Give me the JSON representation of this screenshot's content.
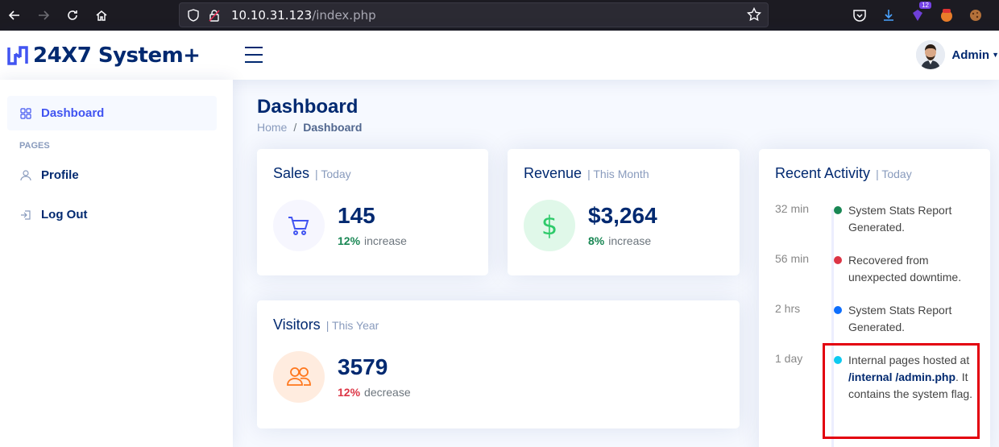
{
  "browser": {
    "url_host": "10.10.31.123",
    "url_path": "/index.php",
    "extension_badge": "12"
  },
  "header": {
    "logo_text": "24X7 System+",
    "profile_name": "Admin"
  },
  "sidebar": {
    "items": [
      {
        "label": "Dashboard",
        "icon": "grid-icon",
        "active": true
      },
      {
        "label": "Profile",
        "icon": "person-icon",
        "active": false
      },
      {
        "label": "Log Out",
        "icon": "logout-icon",
        "active": false
      }
    ],
    "heading": "PAGES"
  },
  "page": {
    "title": "Dashboard",
    "breadcrumb": [
      "Home",
      "Dashboard"
    ]
  },
  "cards": {
    "sales": {
      "title": "Sales",
      "period": "| Today",
      "value": "145",
      "pct": "12%",
      "trend": "increase",
      "icon": "cart-icon"
    },
    "revenue": {
      "title": "Revenue",
      "period": "| This Month",
      "value": "$3,264",
      "pct": "8%",
      "trend": "increase",
      "icon": "dollar-icon"
    },
    "visitors": {
      "title": "Visitors",
      "period": "| This Year",
      "value": "3579",
      "pct": "12%",
      "trend": "decrease",
      "icon": "people-icon"
    }
  },
  "activity": {
    "title": "Recent Activity",
    "period": "| Today",
    "items": [
      {
        "time": "32 min",
        "text": "System Stats Report Generated.",
        "color": "#198754"
      },
      {
        "time": "56 min",
        "text": "Recovered from unexpected downtime.",
        "color": "#dc3545"
      },
      {
        "time": "2 hrs",
        "text": "System Stats Report Generated.",
        "color": "#0d6efd"
      },
      {
        "time": "1 day",
        "text_pre": "Internal pages hosted at ",
        "text_bold": "/internal /admin.php",
        "text_post": ". It contains the system flag.",
        "color": "#0dcaf0"
      }
    ]
  },
  "colors": {
    "accent": "#4154f1",
    "navy": "#012970",
    "highlight": "#e3000f"
  }
}
